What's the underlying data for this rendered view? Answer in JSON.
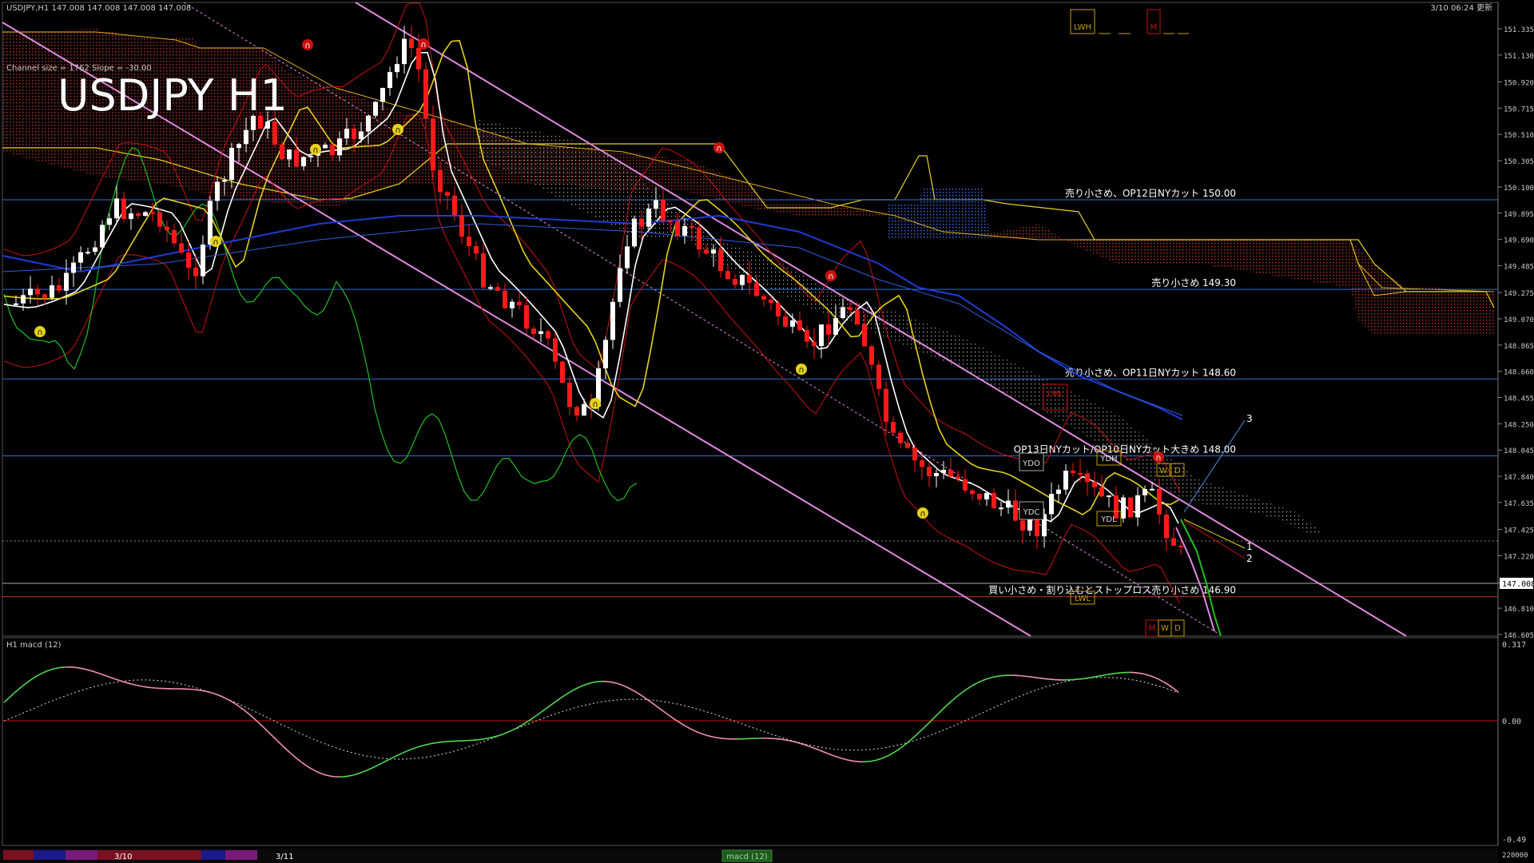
{
  "header": {
    "symbol_info": "USDJPY,H1  147.008 147.008 147.008 147.008",
    "channel_info": "Channel size = 1762 Slope = -30.00",
    "big_title": "USDJPY H1",
    "updated": "3/10 06:24 更新"
  },
  "corner_boxes": {
    "lwh": "LWH",
    "m": "M"
  },
  "price_axis": {
    "ticks": [
      "151.335",
      "151.130",
      "150.920",
      "150.715",
      "150.510",
      "150.305",
      "150.100",
      "149.895",
      "149.690",
      "149.485",
      "149.275",
      "149.070",
      "148.865",
      "148.660",
      "148.455",
      "148.250",
      "148.045",
      "147.840",
      "147.635",
      "147.425",
      "147.220",
      "147.008",
      "146.810",
      "146.605"
    ],
    "current": "147.008"
  },
  "levels": [
    {
      "label": "売り小さめ、OP12日NYカット 150.00",
      "price": 150.0,
      "color": "#2f6fd6"
    },
    {
      "label": "売り小さめ 149.30",
      "price": 149.3,
      "color": "#2f6fd6"
    },
    {
      "label": "売り小さめ、OP11日NYカット 148.60",
      "price": 148.6,
      "color": "#2f6fd6"
    },
    {
      "label": "OP13日NYカット/OP10日NYカット大きめ 148.00",
      "price": 148.0,
      "color": "#2f6fd6"
    },
    {
      "label": "買い小さめ・割り込むとストップロス売り小さめ 146.90",
      "price": 146.9,
      "color": "#c0392b"
    }
  ],
  "markers": {
    "ydo": "YDO",
    "ydh": "YDH",
    "ydc": "YDC",
    "ydl": "YDL",
    "lwl": "LWL",
    "lml": "LML",
    "w": "W",
    "d": "D",
    "m": "M"
  },
  "projection_labels": [
    "3",
    "1",
    "2"
  ],
  "macd": {
    "title": "H1  macd (12)",
    "ticks": [
      "0.317",
      "0.00",
      "-0.49"
    ],
    "bottom_value": "220000"
  },
  "bottom_bar": {
    "dates": [
      "3/10",
      "3/11"
    ],
    "tab_label": "macd (12)"
  },
  "colors": {
    "up_candle": "#ffffff",
    "down_candle": "#ff1a1a",
    "ema_white": "#ffffff",
    "ema_yellow": "#e6d21a",
    "ema_blue": "#1f3bd6",
    "bollinger": "#cc1111",
    "chikou": "#1fbf1f",
    "channel": "#e08ae0",
    "macd_up": "#4fd94f",
    "macd_down": "#f090b0"
  }
}
